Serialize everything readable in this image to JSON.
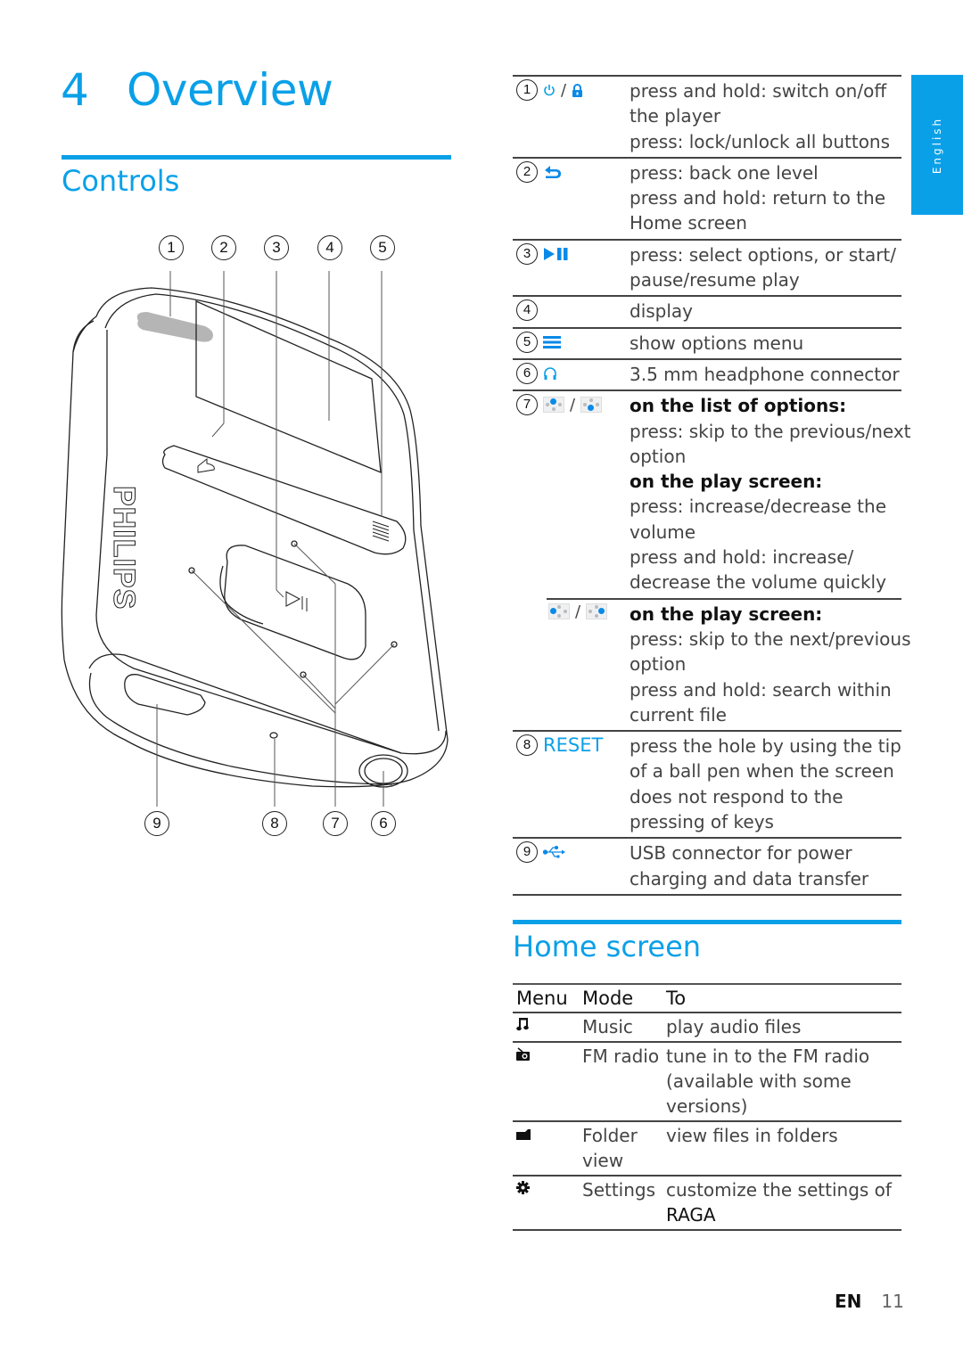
{
  "chapter": {
    "number": "4",
    "title": "Overview"
  },
  "language_tab": "English",
  "sections": {
    "controls": "Controls",
    "home_screen": "Home screen"
  },
  "colors": {
    "accent": "#0aa0e8",
    "text": "#444444"
  },
  "diagram": {
    "brand": "PHILIPS",
    "top_callouts": [
      "1",
      "2",
      "3",
      "4",
      "5"
    ],
    "bottom_callouts": [
      "9",
      "8",
      "7",
      "6"
    ]
  },
  "controls": [
    {
      "num": "1",
      "icons": [
        "power-icon",
        "lock-icon"
      ],
      "key_label": "",
      "lines": [
        {
          "text": "press and hold: switch on/off",
          "bold": false
        },
        {
          "text": "the player",
          "bold": false
        },
        {
          "text": "press: lock/unlock all buttons",
          "bold": false
        }
      ]
    },
    {
      "num": "2",
      "icons": [
        "back-icon"
      ],
      "key_label": "",
      "lines": [
        {
          "text": "press: back one level",
          "bold": false
        },
        {
          "text": "press and hold: return to the",
          "bold": false
        },
        {
          "text": "Home screen",
          "bold": false
        }
      ]
    },
    {
      "num": "3",
      "icons": [
        "play-pause-icon"
      ],
      "key_label": "",
      "lines": [
        {
          "text": "press: select options, or start/",
          "bold": false
        },
        {
          "text": "pause/resume play",
          "bold": false
        }
      ]
    },
    {
      "num": "4",
      "icons": [],
      "key_label": "",
      "lines": [
        {
          "text": "display",
          "bold": false
        }
      ]
    },
    {
      "num": "5",
      "icons": [
        "menu-icon"
      ],
      "key_label": "",
      "lines": [
        {
          "text": "show options menu",
          "bold": false
        }
      ]
    },
    {
      "num": "6",
      "icons": [
        "headphone-icon"
      ],
      "key_label": "",
      "lines": [
        {
          "text": "3.5 mm headphone connector",
          "bold": false
        }
      ]
    },
    {
      "num": "7",
      "icons": [
        "dpad-up-icon",
        "dpad-down-icon"
      ],
      "key_label": "",
      "lines": [
        {
          "text": "on the list of options:",
          "bold": true
        },
        {
          "text": "press: skip to the previous/next",
          "bold": false
        },
        {
          "text": "option",
          "bold": false
        },
        {
          "text": "on the play screen:",
          "bold": true
        },
        {
          "text": "press: increase/decrease the",
          "bold": false
        },
        {
          "text": "volume",
          "bold": false
        },
        {
          "text": "press and hold: increase/",
          "bold": false
        },
        {
          "text": "decrease the volume quickly",
          "bold": false
        }
      ]
    },
    {
      "num": "",
      "icons": [
        "dpad-left-icon",
        "dpad-right-icon"
      ],
      "key_label": "",
      "lines": [
        {
          "text": "on the play screen:",
          "bold": true
        },
        {
          "text": "press: skip to the next/previous",
          "bold": false
        },
        {
          "text": "option",
          "bold": false
        },
        {
          "text": "press and hold: search within",
          "bold": false
        },
        {
          "text": "current file",
          "bold": false
        }
      ]
    },
    {
      "num": "8",
      "icons": [],
      "key_label": "RESET",
      "lines": [
        {
          "text": "press the hole by using the tip",
          "bold": false
        },
        {
          "text": "of a ball pen when the screen",
          "bold": false
        },
        {
          "text": "does not respond to the",
          "bold": false
        },
        {
          "text": "pressing of keys",
          "bold": false
        }
      ]
    },
    {
      "num": "9",
      "icons": [
        "usb-icon"
      ],
      "key_label": "",
      "lines": [
        {
          "text": "USB connector for power",
          "bold": false
        },
        {
          "text": "charging and data transfer",
          "bold": false
        }
      ]
    }
  ],
  "home_table": {
    "headers": [
      "Menu",
      "Mode",
      "To"
    ],
    "rows": [
      {
        "icon": "music-note-icon",
        "mode": [
          "Music"
        ],
        "to": [
          "play audio files"
        ]
      },
      {
        "icon": "radio-icon",
        "mode": [
          "FM radio"
        ],
        "to": [
          "tune in to the FM radio",
          "(available with some",
          "versions)"
        ]
      },
      {
        "icon": "folder-icon",
        "mode": [
          "Folder",
          "view"
        ],
        "to": [
          "view files in folders"
        ]
      },
      {
        "icon": "settings-gear-icon",
        "mode": [
          "Settings"
        ],
        "to": [
          "customize the settings of"
        ],
        "to_bold": "RAGA"
      }
    ]
  },
  "footer": {
    "lang": "EN",
    "page": "11"
  }
}
